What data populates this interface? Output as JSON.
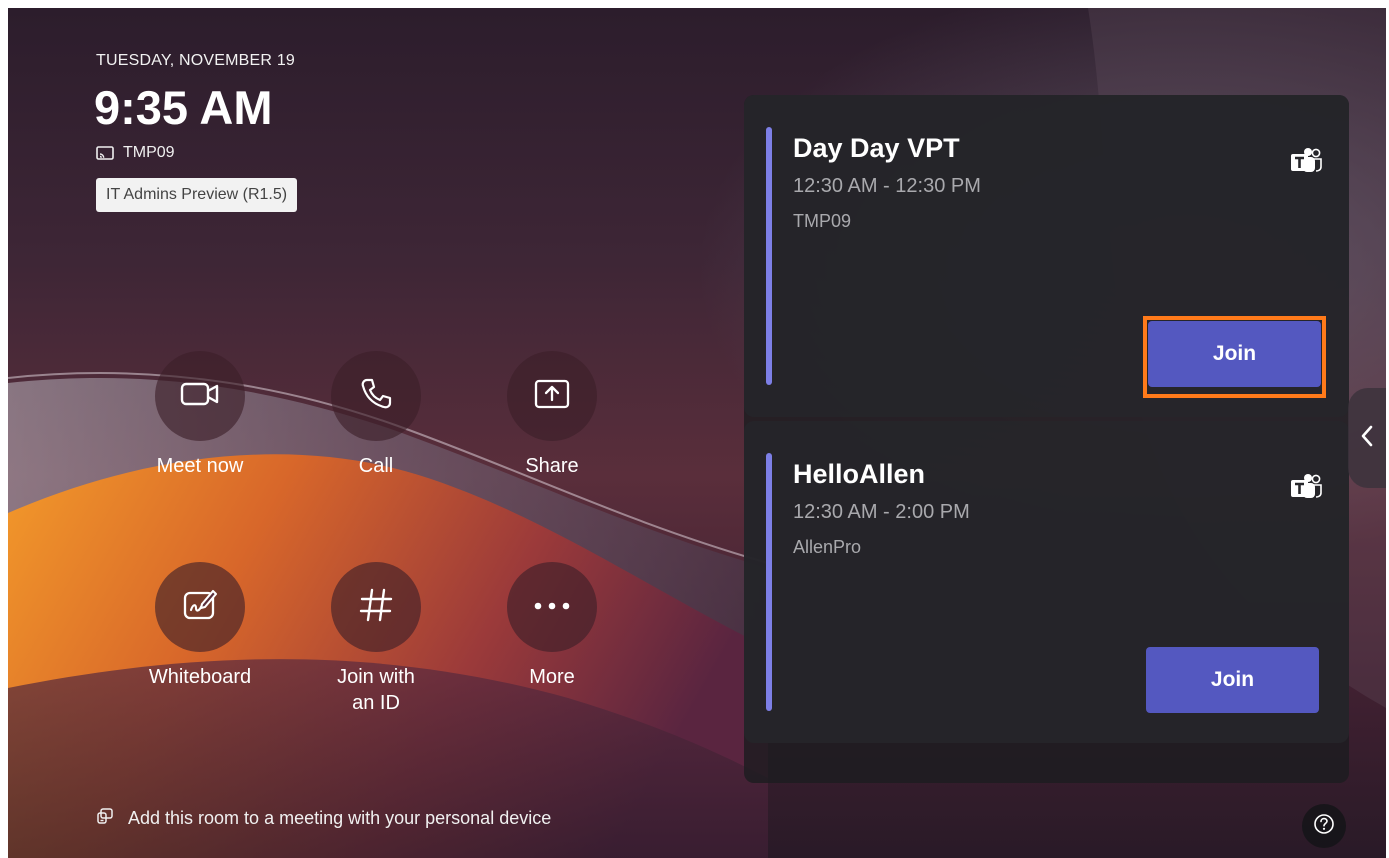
{
  "header": {
    "date": "TUESDAY, NOVEMBER 19",
    "time": "9:35 AM",
    "room_name": "TMP09",
    "preview_badge": "IT Admins Preview (R1.5)"
  },
  "actions": [
    {
      "label": "Meet now",
      "icon": "video-camera-icon"
    },
    {
      "label": "Call",
      "icon": "phone-icon"
    },
    {
      "label": "Share",
      "icon": "share-screen-icon"
    },
    {
      "label": "Whiteboard",
      "icon": "whiteboard-icon"
    },
    {
      "label_line1": "Join with",
      "label_line2": "an ID",
      "icon": "hash-icon"
    },
    {
      "label": "More",
      "icon": "more-icon"
    }
  ],
  "meetings": [
    {
      "title": "Day Day VPT",
      "time_range": "12:30 AM - 12:30 PM",
      "location": "TMP09",
      "join_label": "Join",
      "icon": "teams-icon"
    },
    {
      "title": "HelloAllen",
      "time_range": "12:30 AM - 2:00 PM",
      "location": "AllenPro",
      "join_label": "Join",
      "icon": "teams-icon"
    }
  ],
  "footer": {
    "text": "Add this room to a meeting with your personal device",
    "icon": "proximity-join-icon"
  },
  "colors": {
    "accent": "#7d7fe6",
    "join_button": "#5458c0",
    "highlight": "#ff7a1a"
  }
}
